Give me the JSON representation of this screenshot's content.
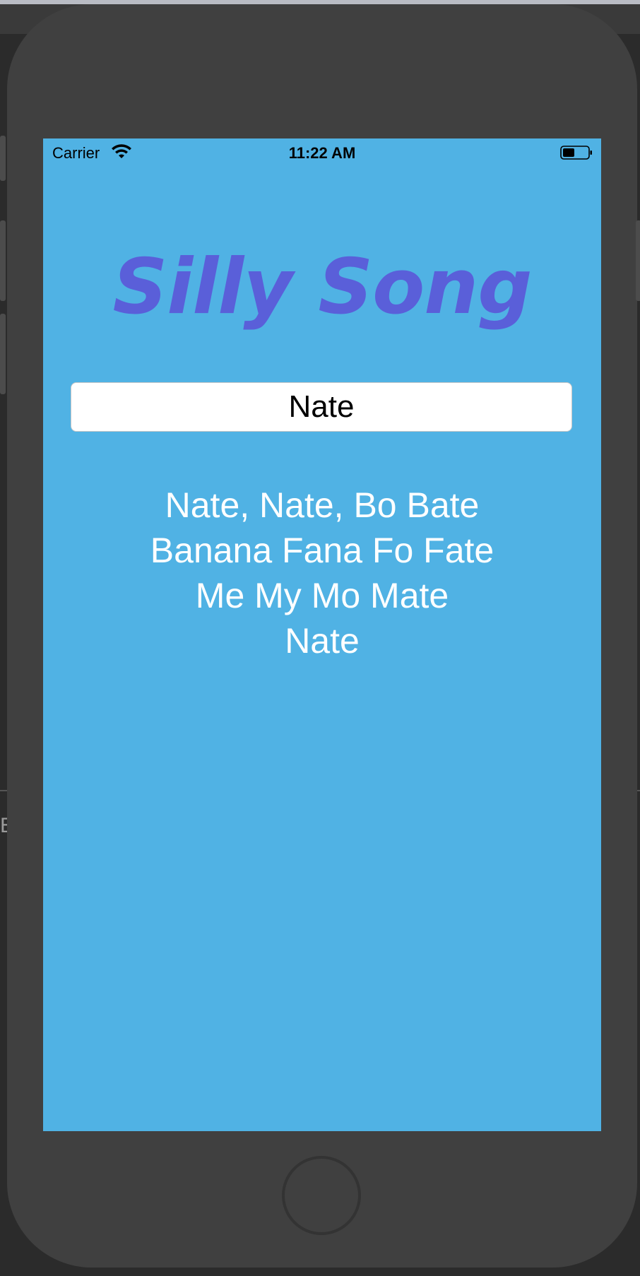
{
  "status_bar": {
    "carrier": "Carrier",
    "time": "11:22 AM",
    "wifi_icon": "wifi-icon",
    "battery_icon": "battery-icon"
  },
  "app": {
    "title": "Silly Song",
    "title_color": "#5a5fd9",
    "background_color": "#50b2e4"
  },
  "name_field": {
    "value": "Nate"
  },
  "lyrics": [
    "Nate, Nate, Bo Bate",
    "Banana Fana Fo Fate",
    "Me My Mo Mate",
    "Nate"
  ],
  "simulator": {
    "side_text": "E"
  }
}
